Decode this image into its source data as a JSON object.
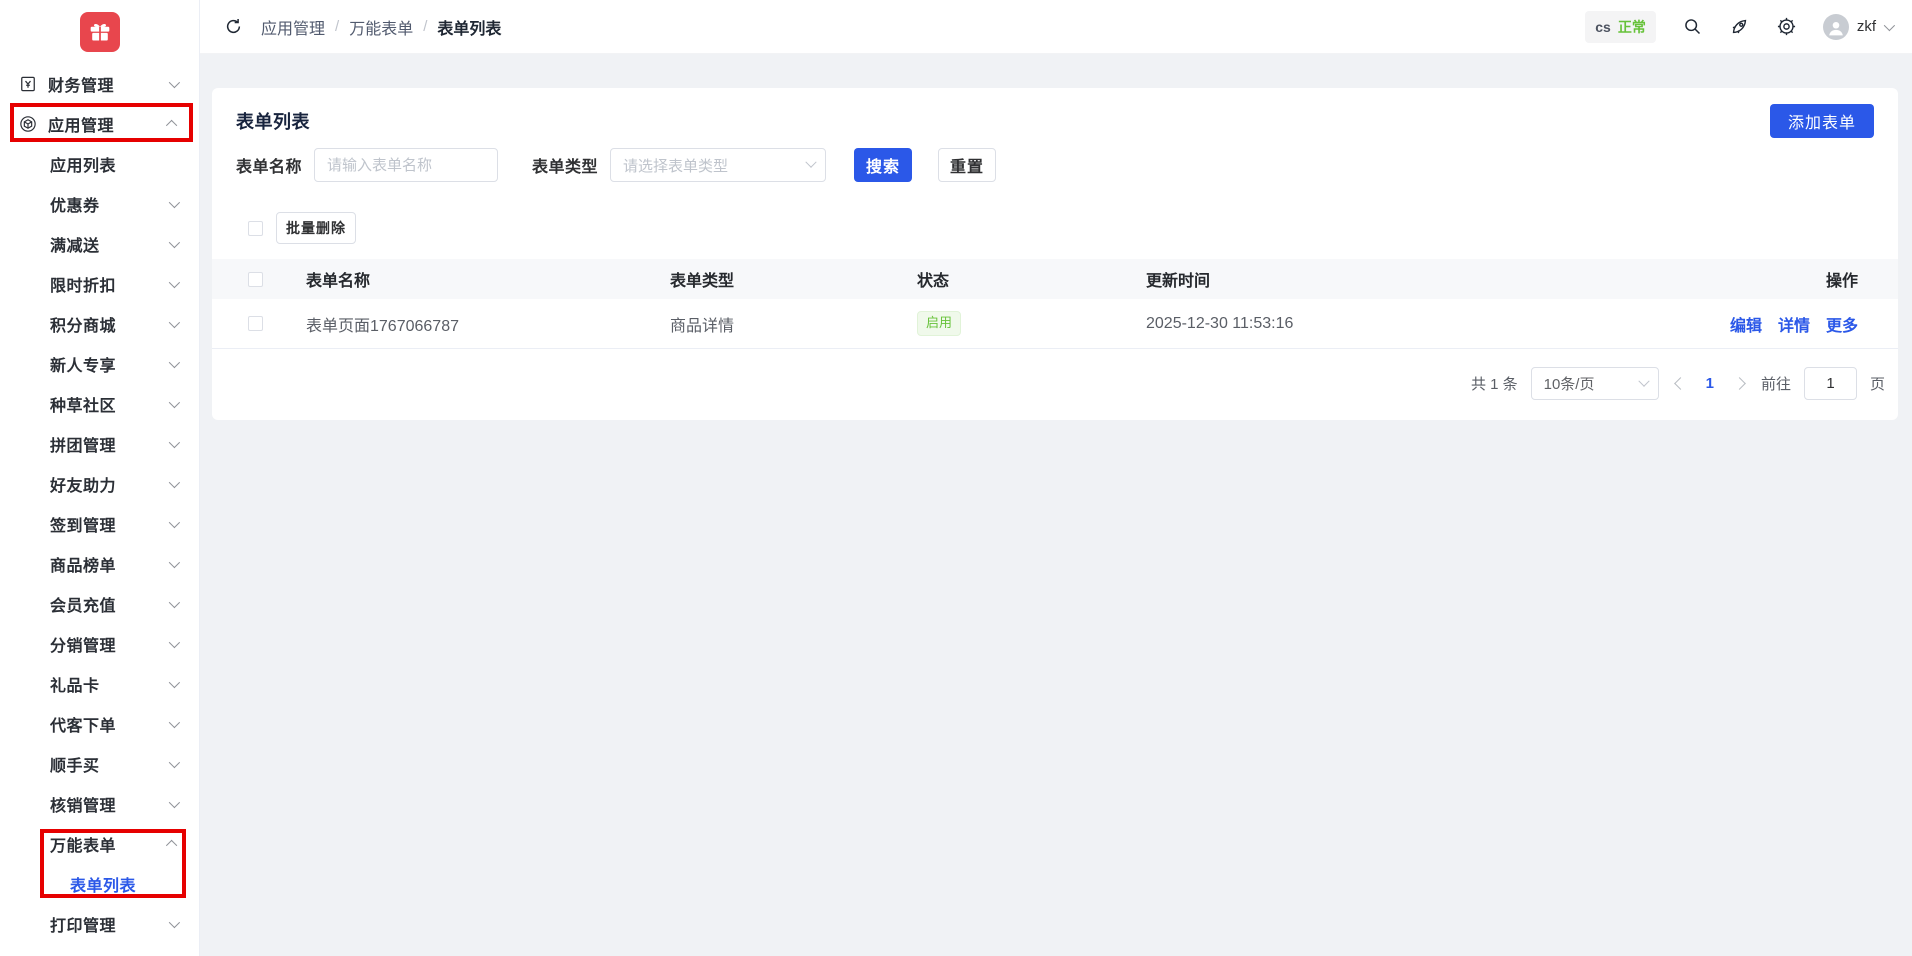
{
  "colors": {
    "accent": "#2b58e8",
    "brand_red": "#e8464d",
    "annotation_red": "#e60000",
    "success_green": "#67c23a"
  },
  "sidebar": {
    "items": [
      {
        "key": "finance",
        "label": "财务管理",
        "level": 1,
        "icon": "finance-icon",
        "chevron": "down"
      },
      {
        "key": "apps",
        "label": "应用管理",
        "level": 1,
        "icon": "app-icon",
        "chevron": "up"
      },
      {
        "key": "app-list",
        "label": "应用列表",
        "level": 2,
        "chevron": "none"
      },
      {
        "key": "coupon",
        "label": "优惠券",
        "level": 2,
        "chevron": "down"
      },
      {
        "key": "full-discount",
        "label": "满减送",
        "level": 2,
        "chevron": "down"
      },
      {
        "key": "limited-discount",
        "label": "限时折扣",
        "level": 2,
        "chevron": "down"
      },
      {
        "key": "points-mall",
        "label": "积分商城",
        "level": 2,
        "chevron": "down"
      },
      {
        "key": "newcomer",
        "label": "新人专享",
        "level": 2,
        "chevron": "down"
      },
      {
        "key": "community",
        "label": "种草社区",
        "level": 2,
        "chevron": "down"
      },
      {
        "key": "group-buy",
        "label": "拼团管理",
        "level": 2,
        "chevron": "down"
      },
      {
        "key": "friend-assist",
        "label": "好友助力",
        "level": 2,
        "chevron": "down"
      },
      {
        "key": "check-in",
        "label": "签到管理",
        "level": 2,
        "chevron": "down"
      },
      {
        "key": "product-ranking",
        "label": "商品榜单",
        "level": 2,
        "chevron": "down"
      },
      {
        "key": "member-recharge",
        "label": "会员充值",
        "level": 2,
        "chevron": "down"
      },
      {
        "key": "distribution",
        "label": "分销管理",
        "level": 2,
        "chevron": "down"
      },
      {
        "key": "gift-card",
        "label": "礼品卡",
        "level": 2,
        "chevron": "down"
      },
      {
        "key": "agent-order",
        "label": "代客下单",
        "level": 2,
        "chevron": "down"
      },
      {
        "key": "quick-buy",
        "label": "顺手买",
        "level": 2,
        "chevron": "down"
      },
      {
        "key": "verification",
        "label": "核销管理",
        "level": 2,
        "chevron": "down"
      },
      {
        "key": "universal-form",
        "label": "万能表单",
        "level": 2,
        "chevron": "up"
      },
      {
        "key": "form-list",
        "label": "表单列表",
        "level": 3,
        "chevron": "none",
        "active": true
      },
      {
        "key": "print",
        "label": "打印管理",
        "level": 2,
        "chevron": "down"
      }
    ]
  },
  "header": {
    "breadcrumb": [
      "应用管理",
      "万能表单",
      "表单列表"
    ],
    "separator": "/",
    "site_badge": {
      "name": "cs",
      "status": "正常"
    },
    "user": "zkf"
  },
  "page": {
    "title": "表单列表",
    "add_button": "添加表单",
    "filters": {
      "name_label": "表单名称",
      "name_placeholder": "请输入表单名称",
      "type_label": "表单类型",
      "type_placeholder": "请选择表单类型",
      "search_button": "搜索",
      "reset_button": "重置"
    },
    "batch_delete_button": "批量删除",
    "table": {
      "columns": [
        "表单名称",
        "表单类型",
        "状态",
        "更新时间",
        "操作"
      ],
      "rows": [
        {
          "name": "表单页面1767066787",
          "type": "商品详情",
          "status": "启用",
          "updated": "2025-12-30 11:53:16",
          "actions": [
            "编辑",
            "详情",
            "更多"
          ]
        }
      ]
    },
    "pagination": {
      "total": "共 1 条",
      "page_size": "10条/页",
      "current_page": "1",
      "goto_label": "前往",
      "goto_value": "1",
      "page_label": "页"
    }
  }
}
